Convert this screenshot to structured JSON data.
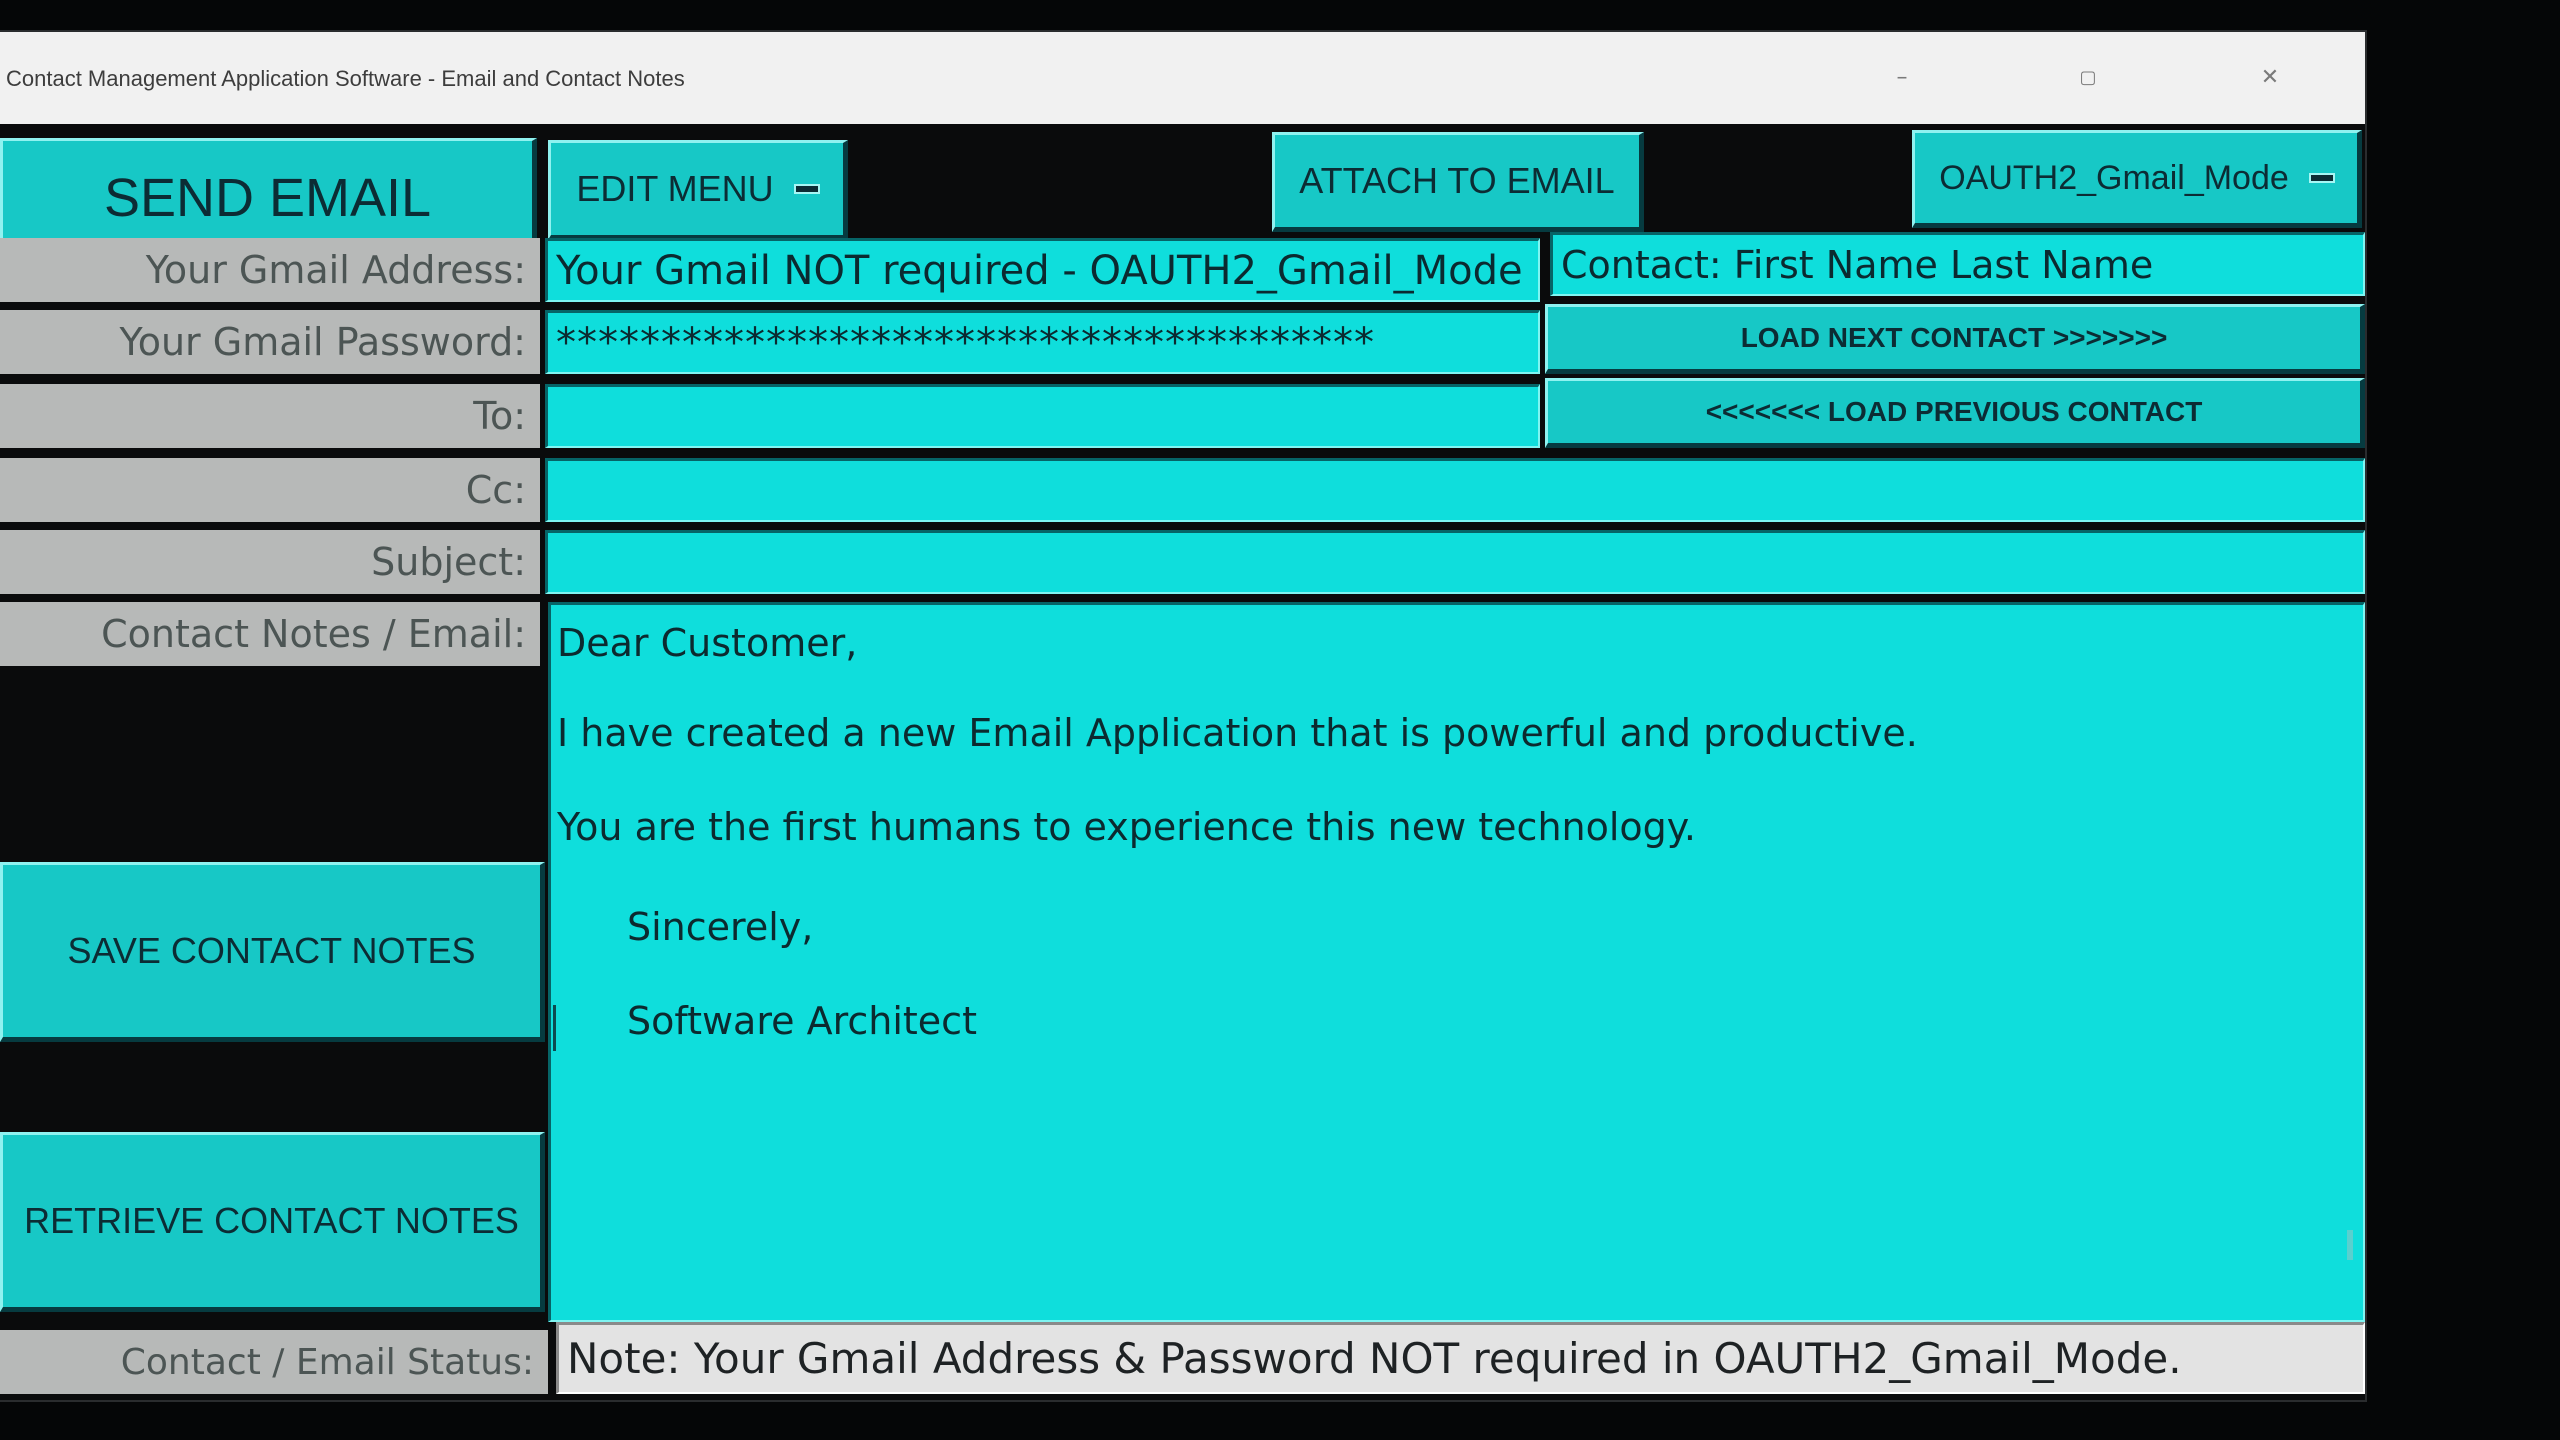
{
  "window": {
    "title": "Contact Management Application Software - Email and Contact Notes",
    "minimize": "–",
    "restore": "▢",
    "close": "✕"
  },
  "toolbar": {
    "send_email": "SEND EMAIL",
    "edit_menu": "EDIT MENU",
    "attach": "ATTACH TO EMAIL",
    "mode": "OAUTH2_Gmail_Mode"
  },
  "labels": {
    "gmail_address": "Your Gmail Address:",
    "gmail_password": "Your Gmail Password:",
    "to": "To:",
    "cc": "Cc:",
    "subject": "Subject:",
    "notes": "Contact Notes / Email:",
    "status": "Contact / Email Status:"
  },
  "fields": {
    "gmail_address": "Your Gmail NOT required - OAUTH2_Gmail_Mode",
    "gmail_password": "***************************************",
    "to": "",
    "cc": "",
    "subject": ""
  },
  "contact": {
    "name": "Contact: First Name Last Name",
    "load_next": "LOAD NEXT CONTACT >>>>>>>",
    "load_previous": "<<<<<<< LOAD PREVIOUS CONTACT"
  },
  "notes": {
    "lines": [
      "Dear Customer,",
      "I have created a new Email Application that is powerful and productive.",
      "You are the first humans to experience this new technology.",
      "Sincerely,",
      "Software Architect"
    ]
  },
  "side_buttons": {
    "save_notes": "SAVE CONTACT NOTES",
    "retrieve_notes": "RETRIEVE CONTACT NOTES"
  },
  "status": {
    "text": "Note: Your Gmail Address & Password NOT required in OAUTH2_Gmail_Mode."
  },
  "colors": {
    "accent": "#17c8c6",
    "field": "#0fdedc",
    "label_bg": "#b7b9b8",
    "background": "#0a0b0c"
  }
}
